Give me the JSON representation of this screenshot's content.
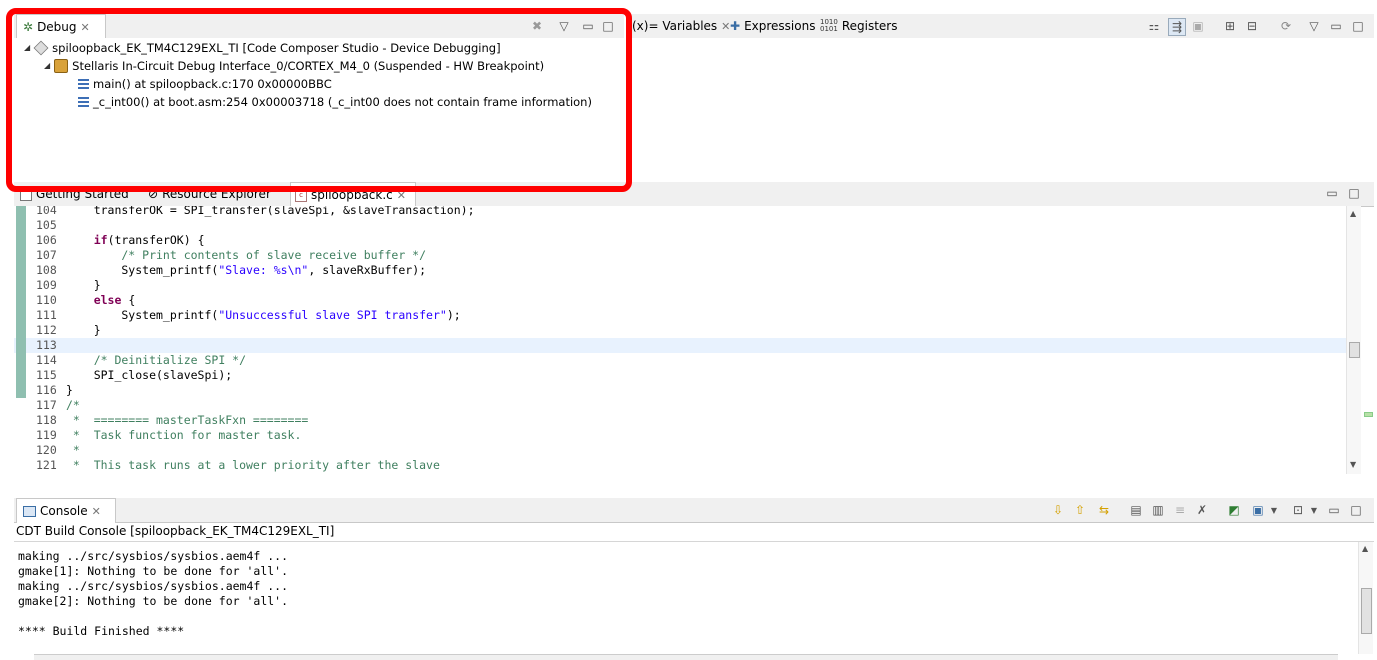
{
  "debug_view": {
    "tab_label": "Debug",
    "tree": [
      {
        "text": "spiloopback_EK_TM4C129EXL_TI [Code Composer Studio - Device Debugging]",
        "level": 0
      },
      {
        "text": "Stellaris In-Circuit Debug Interface_0/CORTEX_M4_0 (Suspended - HW Breakpoint)",
        "level": 1
      },
      {
        "text": "main() at spiloopback.c:170 0x00000BBC",
        "level": 2
      },
      {
        "text": "_c_int00() at boot.asm:254 0x00003718  (_c_int00 does not contain frame information)",
        "level": 2
      }
    ]
  },
  "right_tabs": {
    "variables": "(x)= Variables",
    "expressions": "Expressions",
    "registers": "Registers"
  },
  "editor_tabs": {
    "getting_started": "Getting Started",
    "resource_explorer": "Resource Explorer",
    "file": "spiloopback.c"
  },
  "code": [
    {
      "n": "104",
      "segs": [
        {
          "t": "    transferOK = SPI_transfer(slaveSpi, &slaveTransaction);",
          "c": ""
        }
      ]
    },
    {
      "n": "105",
      "segs": [
        {
          "t": "",
          "c": ""
        }
      ]
    },
    {
      "n": "106",
      "segs": [
        {
          "t": "    ",
          "c": ""
        },
        {
          "t": "if",
          "c": "kw"
        },
        {
          "t": "(transferOK) {",
          "c": ""
        }
      ]
    },
    {
      "n": "107",
      "segs": [
        {
          "t": "        /* Print contents of slave receive buffer */",
          "c": "cmt"
        }
      ]
    },
    {
      "n": "108",
      "segs": [
        {
          "t": "        System_printf(",
          "c": ""
        },
        {
          "t": "\"Slave: %s\\n\"",
          "c": "str"
        },
        {
          "t": ", slaveRxBuffer);",
          "c": ""
        }
      ]
    },
    {
      "n": "109",
      "segs": [
        {
          "t": "    }",
          "c": ""
        }
      ]
    },
    {
      "n": "110",
      "segs": [
        {
          "t": "    ",
          "c": ""
        },
        {
          "t": "else",
          "c": "kw"
        },
        {
          "t": " {",
          "c": ""
        }
      ]
    },
    {
      "n": "111",
      "segs": [
        {
          "t": "        System_printf(",
          "c": ""
        },
        {
          "t": "\"Unsuccessful slave SPI transfer\"",
          "c": "str"
        },
        {
          "t": ");",
          "c": ""
        }
      ]
    },
    {
      "n": "112",
      "segs": [
        {
          "t": "    }",
          "c": ""
        }
      ]
    },
    {
      "n": "113",
      "segs": [
        {
          "t": "",
          "c": ""
        }
      ]
    },
    {
      "n": "114",
      "segs": [
        {
          "t": "    /* Deinitialize SPI */",
          "c": "cmt"
        }
      ]
    },
    {
      "n": "115",
      "segs": [
        {
          "t": "    SPI_close(slaveSpi);",
          "c": ""
        }
      ]
    },
    {
      "n": "116",
      "segs": [
        {
          "t": "}",
          "c": ""
        }
      ]
    },
    {
      "n": "117",
      "segs": [
        {
          "t": "/*",
          "c": "cmt"
        }
      ]
    },
    {
      "n": "118",
      "segs": [
        {
          "t": " *  ======== masterTaskFxn ========",
          "c": "cmt"
        }
      ]
    },
    {
      "n": "119",
      "segs": [
        {
          "t": " *  Task function for master task.",
          "c": "cmt"
        }
      ]
    },
    {
      "n": "120",
      "segs": [
        {
          "t": " *",
          "c": "cmt"
        }
      ]
    },
    {
      "n": "121",
      "segs": [
        {
          "t": " *  This task runs at a lower priority after the slave",
          "c": "cmt"
        }
      ]
    }
  ],
  "console": {
    "tab_label": "Console",
    "subtitle": "CDT Build Console [spiloopback_EK_TM4C129EXL_TI]",
    "lines": [
      "making ../src/sysbios/sysbios.aem4f ...",
      "gmake[1]: Nothing to be done for 'all'.",
      "making ../src/sysbios/sysbios.aem4f ...",
      "gmake[2]: Nothing to be done for 'all'.",
      "",
      "**** Build Finished ****"
    ]
  },
  "colors": {
    "highlight_red": "#ff0000",
    "keyword": "#7f0055",
    "string": "#2a00ff",
    "comment": "#3f7f5f"
  }
}
